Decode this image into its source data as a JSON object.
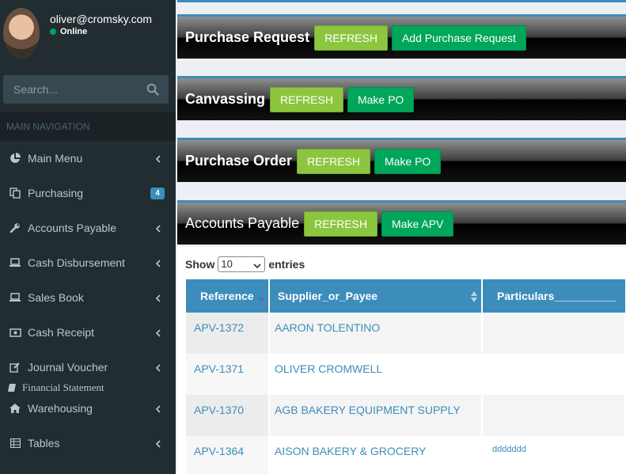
{
  "user": {
    "email": "oliver@cromsky.com",
    "status": "Online"
  },
  "search": {
    "placeholder": "Search..."
  },
  "nav": {
    "header": "MAIN NAVIGATION",
    "items": [
      {
        "label": "Main Menu",
        "icon": "pie-chart-icon"
      },
      {
        "label": "Purchasing",
        "icon": "copy-icon",
        "badge": "4"
      },
      {
        "label": "Accounts Payable",
        "icon": "wrench-icon"
      },
      {
        "label": "Cash Disbursement",
        "icon": "laptop-icon"
      },
      {
        "label": "Sales Book",
        "icon": "laptop-icon"
      },
      {
        "label": "Cash Receipt",
        "icon": "money-icon"
      },
      {
        "label": "Journal Voucher",
        "icon": "edit-icon"
      },
      {
        "label": "Financial Statement",
        "icon": "book-icon"
      },
      {
        "label": "Warehousing",
        "icon": "home-icon"
      },
      {
        "label": "Tables",
        "icon": "table-icon"
      }
    ]
  },
  "panels": {
    "purchase_request": {
      "title": "Purchase Request",
      "refresh": "REFRESH",
      "action": "Add Purchase Request"
    },
    "canvassing": {
      "title": "Canvassing",
      "refresh": "REFRESH",
      "action": "Make PO"
    },
    "purchase_order": {
      "title": "Purchase Order",
      "refresh": "REFRESH",
      "action": "Make PO"
    },
    "accounts_payable": {
      "title": "Accounts Payable",
      "refresh": "REFRESH",
      "action": "Make APV"
    }
  },
  "table": {
    "show_label": "Show",
    "entries_label": "entries",
    "page_size": "10",
    "headers": [
      "Reference",
      "Supplier_or_Payee",
      "Particulars__________"
    ],
    "rows": [
      {
        "reference": "APV-1372",
        "supplier": "AARON TOLENTINO",
        "particulars": ""
      },
      {
        "reference": "APV-1371",
        "supplier": "OLIVER CROMWELL",
        "particulars": ""
      },
      {
        "reference": "APV-1370",
        "supplier": "AGB BAKERY EQUIPMENT SUPPLY",
        "particulars": ""
      },
      {
        "reference": "APV-1364",
        "supplier": "AISON BAKERY & GROCERY",
        "particulars": "ddddddd"
      }
    ]
  },
  "colors": {
    "sidebar": "#222d32",
    "accent": "#3c8dbc",
    "refresh": "#8cc63f",
    "success": "#00a65a"
  }
}
